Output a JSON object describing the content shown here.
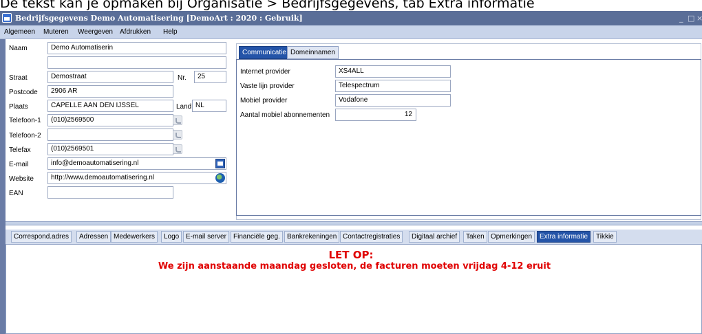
{
  "caption": "De tekst kan je opmaken bij Organisatie > Bedrijfsgegevens, tab Extra informatie",
  "window": {
    "title": "Bedrijfsgegevens Demo Automatisering  [DemoArt : 2020 : Gebruik]",
    "min": "_",
    "max": "□",
    "close": "×"
  },
  "menu": [
    "Algemeen",
    "Muteren",
    "Weergeven",
    "Afdrukken",
    "Help"
  ],
  "form": {
    "naam_label": "Naam",
    "naam": "Demo Automatiserin",
    "naam2": "",
    "straat_label": "Straat",
    "straat": "Demostraat",
    "nr_label": "Nr.",
    "nr": "25",
    "postcode_label": "Postcode",
    "postcode": "2906 AR",
    "plaats_label": "Plaats",
    "plaats": "CAPELLE AAN DEN IJSSEL",
    "land_label": "Land",
    "land": "NL",
    "tel1_label": "Telefoon-1",
    "tel1": "(010)2569500",
    "tel2_label": "Telefoon-2",
    "tel2": "",
    "fax_label": "Telefax",
    "fax": "(010)2569501",
    "email_label": "E-mail",
    "email": "info@demoautomatisering.nl",
    "website_label": "Website",
    "website": "http://www.demoautomatisering.nl",
    "ean_label": "EAN",
    "ean": ""
  },
  "comm_tabs": [
    "Communicatie",
    "Domeinnamen"
  ],
  "comm": {
    "internet_label": "Internet provider",
    "internet": "XS4ALL",
    "vaste_label": "Vaste lijn provider",
    "vaste": "Telespectrum",
    "mobiel_label": "Mobiel provider",
    "mobiel": "Vodafone",
    "abonnementen_label": "Aantal mobiel abonnementen",
    "abonnementen": "12"
  },
  "bottom_tabs": [
    "Correspond.adres",
    "Adressen",
    "Medewerkers",
    "Logo",
    "E-mail server",
    "Financiële geg.",
    "Bankrekeningen",
    "Contactregistraties",
    "Digitaal archief",
    "Taken",
    "Opmerkingen",
    "Extra informatie",
    "Tikkie"
  ],
  "extra_info": {
    "heading": "LET OP:",
    "text": "We zijn aanstaande maandag gesloten, de facturen moeten vrijdag 4-12 eruit"
  },
  "colors": {
    "accent": "#2454a8",
    "notice": "#e00000",
    "titlebar": "#5a6e98"
  }
}
